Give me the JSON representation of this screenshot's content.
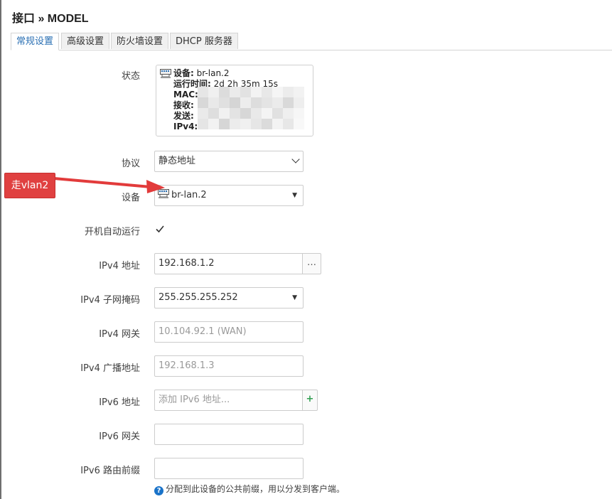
{
  "page": {
    "title": "接口 » MODEL"
  },
  "tabs": [
    {
      "label": "常规设置",
      "active": true
    },
    {
      "label": "高级设置",
      "active": false
    },
    {
      "label": "防火墙设置",
      "active": false
    },
    {
      "label": "DHCP 服务器",
      "active": false
    }
  ],
  "status": {
    "label": "状态",
    "device_key": "设备:",
    "device_value": "br-lan.2",
    "uptime_key": "运行时间:",
    "uptime_value": "2d 2h 35m 15s",
    "mac_key": "MAC:",
    "rx_key": "接收:",
    "tx_key": "发送:",
    "ipv4_key": "IPv4:"
  },
  "protocol": {
    "label": "协议",
    "value": "静态地址"
  },
  "device": {
    "label": "设备",
    "value": "br-lan.2"
  },
  "autostart": {
    "label": "开机自动运行",
    "checked": true
  },
  "ipv4_addr": {
    "label": "IPv4 地址",
    "value": "192.168.1.2",
    "addon": "…"
  },
  "ipv4_mask": {
    "label": "IPv4 子网掩码",
    "value": "255.255.255.252"
  },
  "ipv4_gw": {
    "label": "IPv4 网关",
    "placeholder": "10.104.92.1 (WAN)"
  },
  "ipv4_bcast": {
    "label": "IPv4 广播地址",
    "placeholder": "192.168.1.3"
  },
  "ipv6_addr": {
    "label": "IPv6 地址",
    "placeholder": "添加 IPv6 地址...",
    "addon": "+"
  },
  "ipv6_gw": {
    "label": "IPv6 网关",
    "value": ""
  },
  "ipv6_prefix": {
    "label": "IPv6 路由前缀",
    "value": "",
    "help": "分配到此设备的公共前缀，用以分发到客户端。"
  },
  "annotation": {
    "text": "走vlan2",
    "color": "#e04040"
  },
  "colors": {
    "accent": "#2a6fb3",
    "help_icon": "#1a73c9",
    "checkmark": "#333333"
  }
}
